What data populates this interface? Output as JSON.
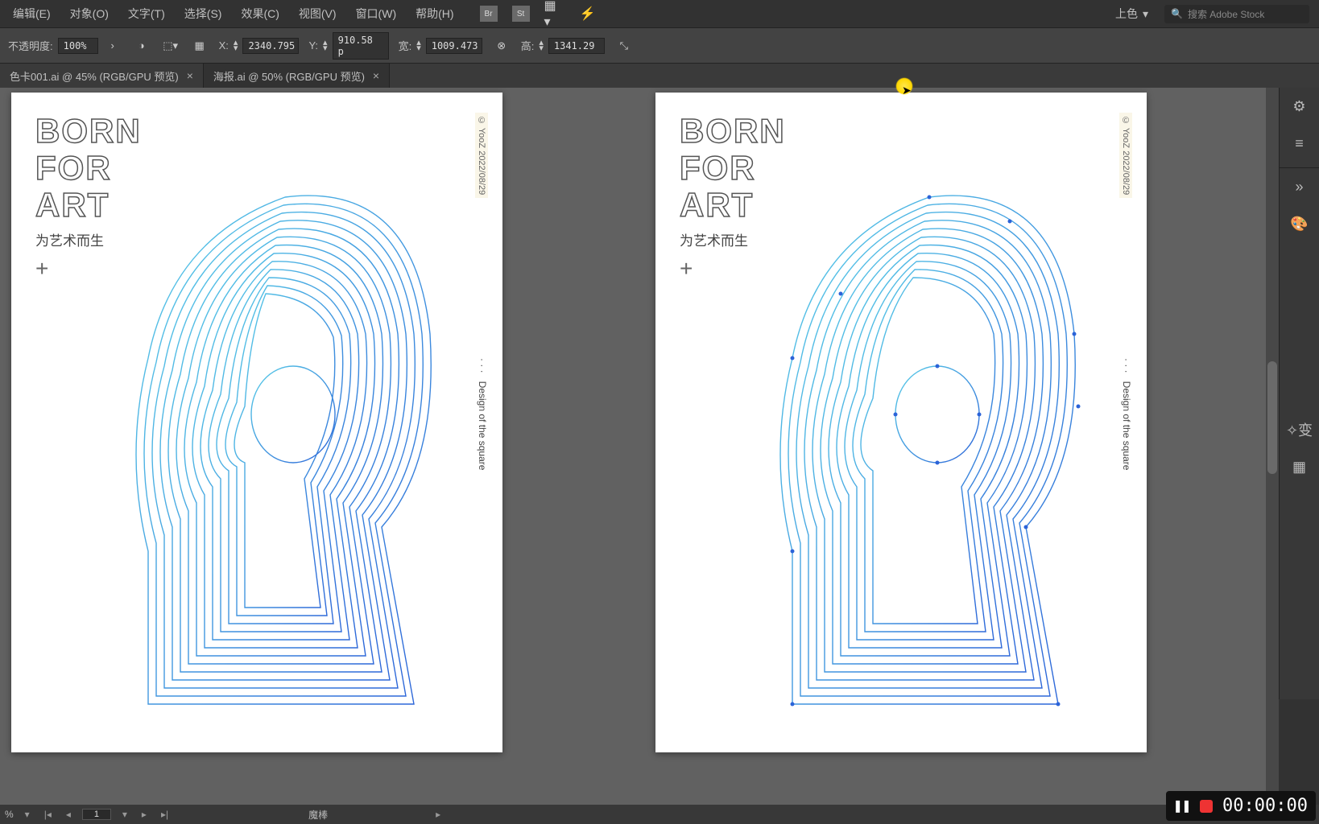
{
  "menu": {
    "items": [
      "编辑(E)",
      "对象(O)",
      "文字(T)",
      "选择(S)",
      "效果(C)",
      "视图(V)",
      "窗口(W)",
      "帮助(H)"
    ],
    "workspace": "上色",
    "search_placeholder": "搜索 Adobe Stock",
    "icon_labels": [
      "Br",
      "St"
    ]
  },
  "options": {
    "opacity_label": "不透明度:",
    "opacity_value": "100%",
    "x_label": "X:",
    "x_value": "2340.795",
    "y_label": "Y:",
    "y_value": "910.58 p",
    "w_label": "宽:",
    "w_value": "1009.473",
    "h_label": "高:",
    "h_value": "1341.29"
  },
  "tabs": [
    {
      "label": "色卡001.ai @ 45% (RGB/GPU 预览)",
      "active": false
    },
    {
      "label": "海报.ai @ 50% (RGB/GPU 预览)",
      "active": true
    }
  ],
  "poster": {
    "line1": "BORN",
    "line2": "FOR",
    "line3": "ART",
    "subtitle": "为艺术而生",
    "plus": "+",
    "credit": "© YooZ  2022/08/29",
    "side_dots": "· · ·",
    "side_text": "Design of the square"
  },
  "status": {
    "page": "1",
    "tool": "魔棒"
  },
  "recorder": {
    "time": "00:00:00"
  }
}
